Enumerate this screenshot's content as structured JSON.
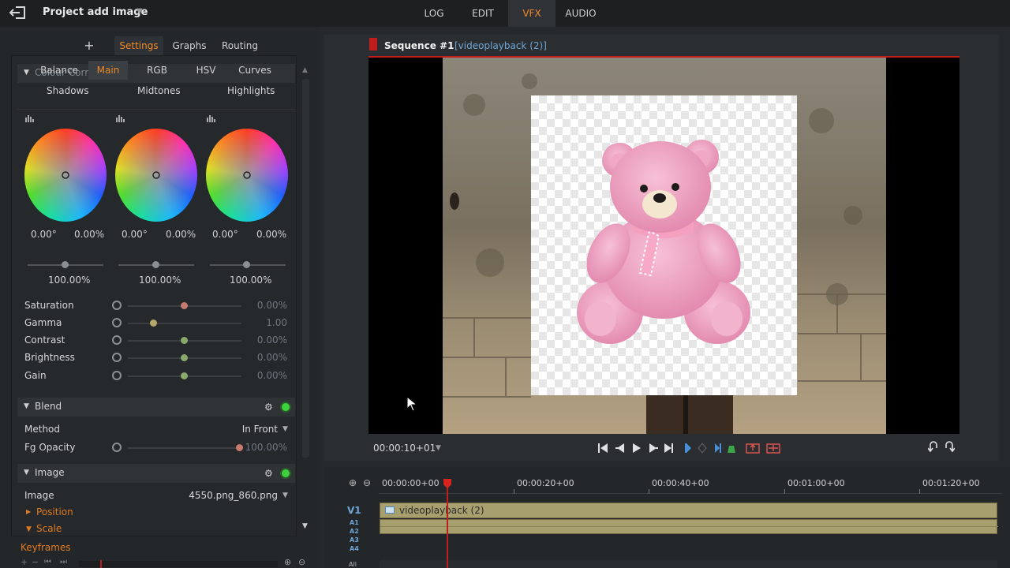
{
  "header": {
    "project_title": "Project add image",
    "tabs": [
      "LOG",
      "EDIT",
      "VFX",
      "AUDIO"
    ],
    "active_tab": "VFX",
    "accent_color": "#f08a24"
  },
  "panel": {
    "tabs": [
      "Settings",
      "Graphs",
      "Routing"
    ],
    "add_symbol": "+",
    "colour_correction": {
      "title": "Colour Correction",
      "subtabs": [
        "Balance",
        "Main",
        "RGB",
        "HSV",
        "Curves"
      ],
      "wheels": [
        {
          "label": "Shadows",
          "hue": "0.00°",
          "sat": "0.00%",
          "level": "100.00%"
        },
        {
          "label": "Midtones",
          "hue": "0.00°",
          "sat": "0.00%",
          "level": "100.00%"
        },
        {
          "label": "Highlights",
          "hue": "0.00°",
          "sat": "0.00%",
          "level": "100.00%"
        }
      ],
      "rows": [
        {
          "label": "Saturation",
          "value": "0.00%"
        },
        {
          "label": "Gamma",
          "value": "1.00"
        },
        {
          "label": "Contrast",
          "value": "0.00%"
        },
        {
          "label": "Brightness",
          "value": "0.00%"
        },
        {
          "label": "Gain",
          "value": "0.00%"
        }
      ]
    },
    "blend": {
      "title": "Blend",
      "method_label": "Method",
      "method_value": "In Front",
      "opacity_label": "Fg Opacity",
      "opacity_value": "100.00%"
    },
    "image": {
      "title": "Image",
      "image_label": "Image",
      "image_value": "4550.png_860.png",
      "position_label": "Position",
      "scale_label": "Scale"
    },
    "keyframes_label": "Keyframes"
  },
  "viewer": {
    "sequence_title": "Sequence #1",
    "sequence_clip": "[videoplayback (2)]",
    "timecode": "00:00:10+01"
  },
  "timeline": {
    "ruler": [
      "00:00:00+00",
      "00:00:20+00",
      "00:00:40+00",
      "00:01:00+00",
      "00:01:20+00"
    ],
    "track_video": "V1",
    "tracks_audio": [
      "A1",
      "A2",
      "A3",
      "A4"
    ],
    "all_label": "All",
    "clip_name": "videoplayback (2)"
  }
}
